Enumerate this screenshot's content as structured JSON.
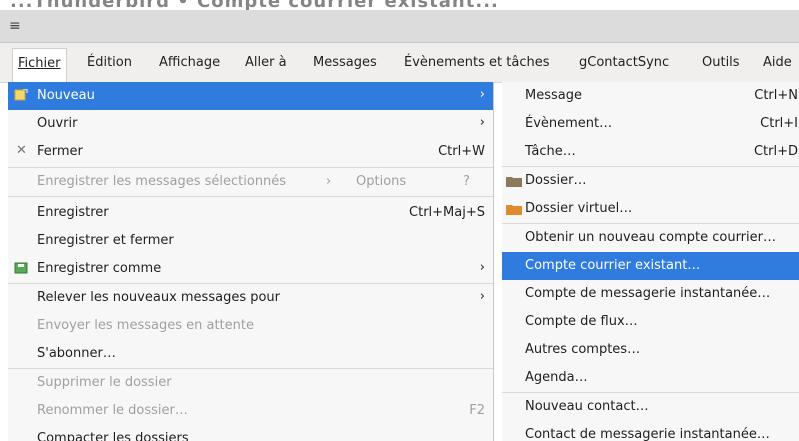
{
  "top_strip_text": "...Thunderbird • Compte courrier existant...",
  "toolbar": {
    "menu_icon": "hamburger-icon"
  },
  "menubar": {
    "items": [
      {
        "label": "Fichier"
      },
      {
        "label": "Édition"
      },
      {
        "label": "Affichage"
      },
      {
        "label": "Aller à"
      },
      {
        "label": "Messages"
      },
      {
        "label": "Évènements et tâches"
      },
      {
        "label": "gContactSync"
      },
      {
        "label": "Outils"
      },
      {
        "label": "Aide"
      }
    ]
  },
  "file_menu": {
    "items": [
      {
        "label": "Nouveau",
        "icon": "new-document-icon",
        "submenu": true,
        "highlighted": true
      },
      {
        "label": "Ouvrir",
        "submenu": true
      },
      {
        "label": "Fermer",
        "icon": "close-icon",
        "shortcut": "Ctrl+W"
      },
      {
        "label": "Enregistrer les messages sélectionnés",
        "disabled": true,
        "extra1": "›",
        "extra2": "Options",
        "extra3": "?"
      },
      {
        "label": "Enregistrer",
        "shortcut": "Ctrl+Maj+S"
      },
      {
        "label": "Enregistrer et fermer"
      },
      {
        "label": "Enregistrer comme",
        "icon": "save-as-icon",
        "submenu": true
      },
      {
        "label": "Relever les nouveaux messages pour",
        "submenu": true
      },
      {
        "label": "Envoyer les messages en attente",
        "disabled": true
      },
      {
        "label": "S'abonner…"
      },
      {
        "label": "Supprimer le dossier",
        "disabled": true
      },
      {
        "label": "Renommer le dossier…",
        "disabled": true,
        "shortcut": "F2"
      },
      {
        "label": "Compacter les dossiers"
      }
    ]
  },
  "new_submenu": {
    "items": [
      {
        "label": "Message",
        "shortcut": "Ctrl+N"
      },
      {
        "label": "Évènement…",
        "shortcut": "Ctrl+I"
      },
      {
        "label": "Tâche…",
        "shortcut": "Ctrl+D"
      },
      {
        "label": "Dossier…",
        "icon": "folder-icon"
      },
      {
        "label": "Dossier virtuel…",
        "icon": "virtual-folder-icon"
      },
      {
        "label": "Obtenir un nouveau compte courrier…"
      },
      {
        "label": "Compte courrier existant…",
        "highlighted": true
      },
      {
        "label": "Compte de messagerie instantanée…"
      },
      {
        "label": "Compte de flux…"
      },
      {
        "label": "Autres comptes…"
      },
      {
        "label": "Agenda…"
      },
      {
        "label": "Nouveau contact…"
      },
      {
        "label": "Contact de messagerie instantanée…"
      }
    ]
  },
  "colors": {
    "highlight": "#2f7bde",
    "menu_bg": "#f7f7f7",
    "disabled_text": "#a0a0a0"
  }
}
